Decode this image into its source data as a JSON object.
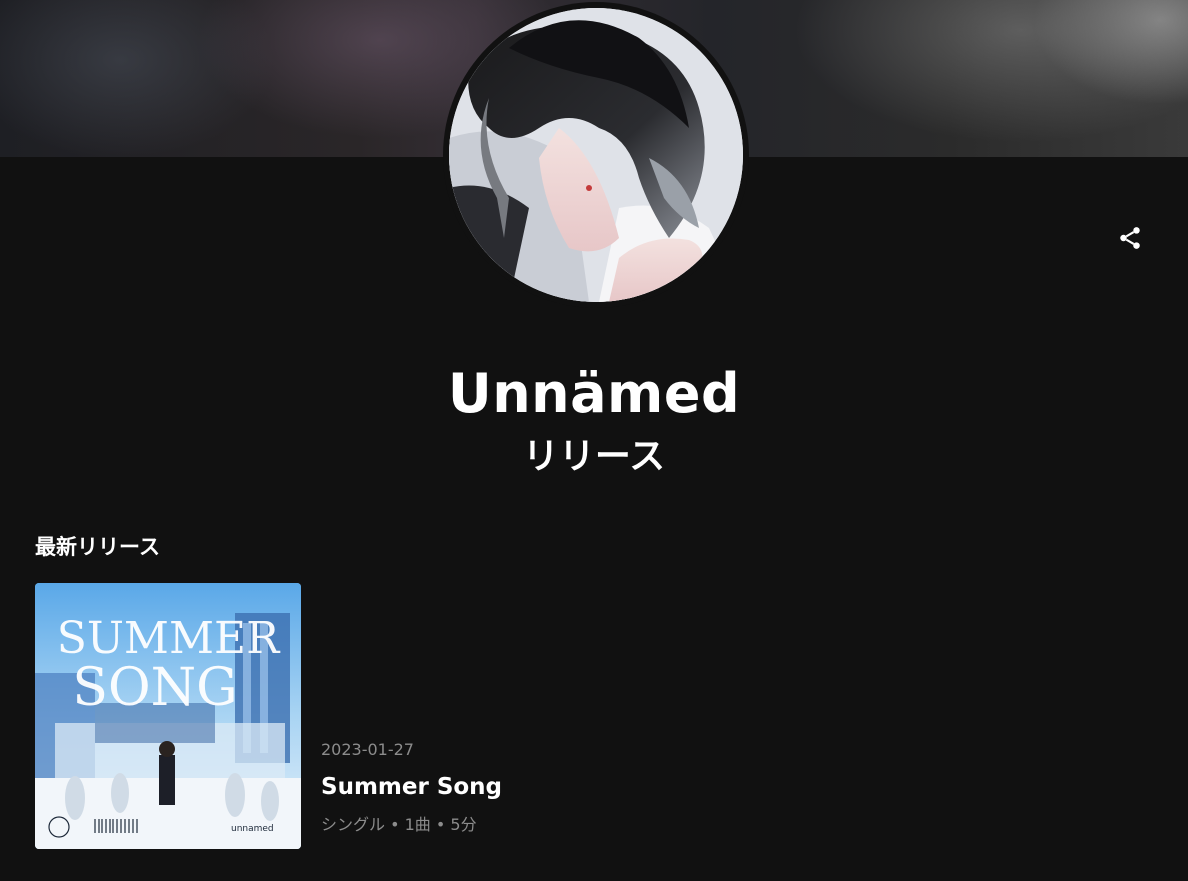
{
  "artist": {
    "name": "Unnämed"
  },
  "page": {
    "subtitle": "リリース"
  },
  "icons": {
    "share": "share-icon"
  },
  "latest_releases": {
    "section_title": "最新リリース",
    "items": [
      {
        "date": "2023-01-27",
        "title": "Summer Song",
        "meta": "シングル • 1曲 • 5分",
        "cover_text_line1": "SUMMER",
        "cover_text_line2": "SONG",
        "cover_credit": "unnamed"
      }
    ]
  },
  "colors": {
    "background": "#111111",
    "text_primary": "#ffffff",
    "text_secondary": "#8c8c8c"
  }
}
